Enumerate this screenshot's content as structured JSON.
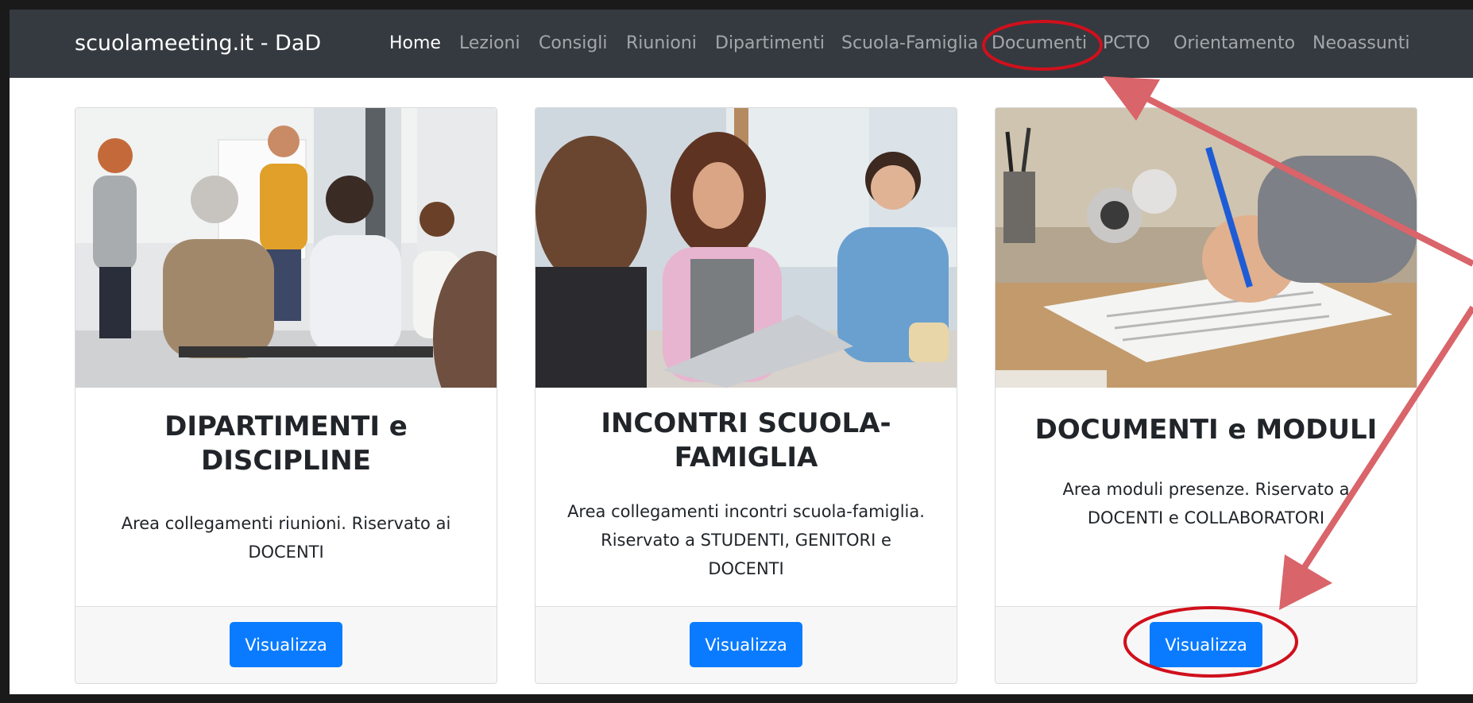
{
  "navbar": {
    "brand": "scuolameeting.it - DaD",
    "items": [
      {
        "label": "Home",
        "active": true
      },
      {
        "label": "Lezioni"
      },
      {
        "label": "Consigli"
      },
      {
        "label": "Riunioni"
      },
      {
        "label": "Dipartimenti"
      },
      {
        "label": "Scuola-Famiglia"
      },
      {
        "label": "Documenti"
      },
      {
        "label": "PCTO"
      },
      {
        "label": "Orientamento"
      },
      {
        "label": "Neoassunti"
      }
    ]
  },
  "cards": [
    {
      "title_line1": "DIPARTIMENTI e",
      "title_line2": "DISCIPLINE",
      "text_lines": [
        "Area collegamenti riunioni. Riservato ai",
        "DOCENTI"
      ],
      "button": "Visualizza"
    },
    {
      "title_line1": "INCONTRI SCUOLA-",
      "title_line2": "FAMIGLIA",
      "text_lines": [
        "Area collegamenti incontri scuola-famiglia.",
        "Riservato a STUDENTI, GENITORI e",
        "DOCENTI"
      ],
      "button": "Visualizza"
    },
    {
      "title_line1": "DOCUMENTI e MODULI",
      "text_lines": [
        "Area moduli presenze. Riservato a",
        "DOCENTI e COLLABORATORI"
      ],
      "button": "Visualizza"
    }
  ],
  "colors": {
    "navbar_bg": "#343a40",
    "button_bg": "#0a7bff",
    "annotation": "#d9646a",
    "circle": "#d0101c"
  }
}
